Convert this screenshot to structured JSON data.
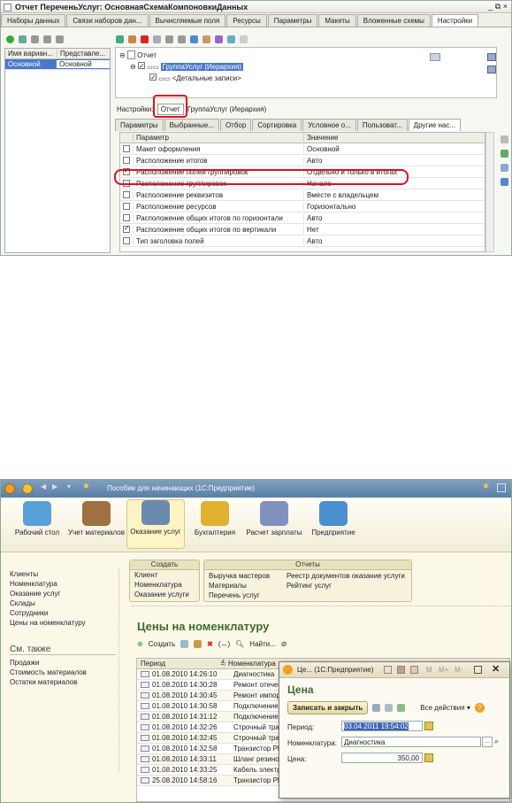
{
  "s1": {
    "window_title": "Отчет ПереченьУслуг: ОсновнаяСхемаКомпоновкиДанных",
    "window_controls": "_ ⧉ ×",
    "tabs": [
      "Наборы данных",
      "Связи наборов дан...",
      "Вычисляемые поля",
      "Ресурсы",
      "Параметры",
      "Макеты",
      "Вложенные схемы",
      "Настройки"
    ],
    "active_tab": "Настройки",
    "variants_grid": {
      "headers": [
        "Имя вариан...",
        "Представле..."
      ],
      "rows": [
        [
          "Основной",
          "Основной"
        ]
      ]
    },
    "tree": {
      "root": "Отчет",
      "group": "ГруппаУслуг (Иерархия)",
      "detail": "<Детальные записи>"
    },
    "settings_row": {
      "label": "Настройки:",
      "report_button": "Отчет",
      "group_link": "ГруппаУслуг (Иерархия)"
    },
    "settings_tabs": [
      "Параметры",
      "Выбранные...",
      "Отбор",
      "Сортировка",
      "Условное о...",
      "Пользоват...",
      "Другие нас..."
    ],
    "params_grid": {
      "headers": [
        "Параметр",
        "Значение"
      ],
      "rows": [
        {
          "checked": false,
          "param": "Макет оформления",
          "value": "Основной"
        },
        {
          "checked": false,
          "param": "Расположение итогов",
          "value": "Авто"
        },
        {
          "checked": true,
          "param": "Расположение полей группировок",
          "value": "Отдельно и только в итогах"
        },
        {
          "checked": false,
          "param": "Расположение группировок",
          "value": "Начало"
        },
        {
          "checked": false,
          "param": "Расположение реквизитов",
          "value": "Вместе с владельцем"
        },
        {
          "checked": false,
          "param": "Расположение ресурсов",
          "value": "Горизонтально"
        },
        {
          "checked": false,
          "param": "Расположение общих итогов по горизонтали",
          "value": "Авто"
        },
        {
          "checked": true,
          "param": "Расположение общих итогов по вертикали",
          "value": "Нет"
        },
        {
          "checked": false,
          "param": "Тип заголовка полей",
          "value": "Авто"
        }
      ]
    }
  },
  "s2": {
    "title": "Пособие для начинающих (1С:Предприятие)",
    "sections": [
      {
        "label": "Рабочий стол",
        "icon": "desk-lamp-icon"
      },
      {
        "label": "Учет материалов",
        "icon": "boxes-icon"
      },
      {
        "label": "Оказание услуг",
        "icon": "cash-register-icon"
      },
      {
        "label": "Бухгалтерия",
        "icon": "coins-icon"
      },
      {
        "label": "Расчет зарплаты",
        "icon": "people-icon"
      },
      {
        "label": "Предприятие",
        "icon": "building-icon"
      }
    ],
    "active_section": "Оказание услуг",
    "left_nav": [
      "Клиенты",
      "Номенклатура",
      "Оказание услуг",
      "Склады",
      "Сотрудники",
      "Цены на номенклатуру"
    ],
    "see_also": "См. также",
    "see_also_items": [
      "Продажи",
      "Стоимость материалов",
      "Остатки материалов"
    ],
    "create_group": {
      "title": "Создать",
      "items": [
        "Клиент",
        "Номенклатура",
        "Оказание услуги"
      ]
    },
    "reports_group": {
      "title": "Отчеты",
      "col1": [
        "Выручка мастеров",
        "Материалы",
        "Перечень услуг"
      ],
      "col2": [
        "Реестр документов оказание услуги",
        "Рейтинг услуг"
      ]
    },
    "list_title": "Цены на номенклатуру",
    "list_toolbar": {
      "create": "Создать",
      "find": "Найти..."
    },
    "table": {
      "headers": [
        "Период",
        "Номенклатура"
      ],
      "rows": [
        [
          "01.08.2010 14:26:10",
          "Диагностика"
        ],
        [
          "01.08.2010 14:30:28",
          "Ремонт отечестве"
        ],
        [
          "01.08.2010 14:30:45",
          "Ремонт импортне"
        ],
        [
          "01.08.2010 14:30:58",
          "Подключение вод"
        ],
        [
          "01.08.2010 14:31:12",
          "Подключение эле"
        ],
        [
          "01.08.2010 14:32:26",
          "Строчный трансф"
        ],
        [
          "01.08.2010 14:32:45",
          "Строчный трансф"
        ],
        [
          "01.08.2010 14:32:58",
          "Транзистор Philip"
        ],
        [
          "01.08.2010 14:33:11",
          "Шланг резиновы"
        ],
        [
          "01.08.2010 14:33:25",
          "Кабель электрич"
        ],
        [
          "25.08.2010 14:58:16",
          "Транзистор Philip"
        ]
      ]
    },
    "dialog": {
      "title": "Це... (1С:Предприятие)",
      "calc_buttons": [
        "M",
        "M+",
        "M-"
      ],
      "heading": "Цена",
      "save_close": "Записать и закрыть",
      "all_actions": "Все действия ▾",
      "period_label": "Период:",
      "period_value": "03.04.2011 19:54:02",
      "nom_label": "Номенклатура:",
      "nom_value": "Диагностика",
      "price_label": "Цена:",
      "price_value": "350,00"
    }
  }
}
